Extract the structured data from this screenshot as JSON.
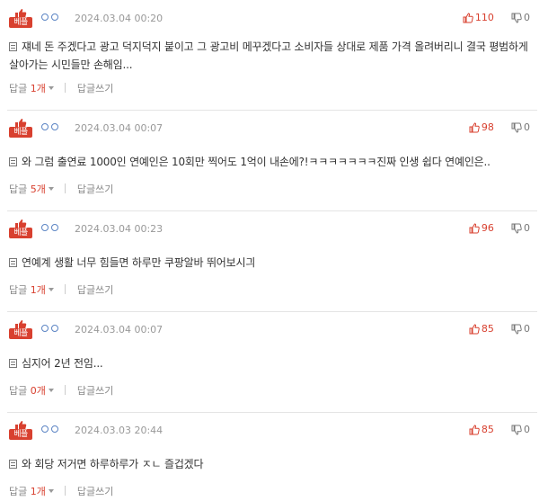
{
  "badge_label": "베플",
  "reply_write_label": "답글쓰기",
  "colors": {
    "accent": "#d8402f",
    "anon_circle": "#5b84c4"
  },
  "comments": [
    {
      "date": "2024.03.04 00:20",
      "up": "110",
      "down": "0",
      "text": "쟤네 돈 주겠다고 광고 덕지덕지 붙이고 그 광고비 메꾸겠다고 소비자들 상대로 제품 가격 올려버리니 결국 평범하게 살아가는 시민들만 손해임...",
      "reply_prefix": "답글",
      "reply_count": "1개"
    },
    {
      "date": "2024.03.04 00:07",
      "up": "98",
      "down": "0",
      "text": "와 그럼 출연료 1000인 연예인은 10회만 찍어도 1억이 내손에?!ㅋㅋㅋㅋㅋㅋㅋ진짜 인생 쉽다 연예인은..",
      "reply_prefix": "답글",
      "reply_count": "5개"
    },
    {
      "date": "2024.03.04 00:23",
      "up": "96",
      "down": "0",
      "text": "연예계 생활 너무 힘들면 하루만 쿠팡알바 뛰어보시긔",
      "reply_prefix": "답글",
      "reply_count": "1개"
    },
    {
      "date": "2024.03.04 00:07",
      "up": "85",
      "down": "0",
      "text": "심지어 2년 전임...",
      "reply_prefix": "답글",
      "reply_count": "0개"
    },
    {
      "date": "2024.03.03 20:44",
      "up": "85",
      "down": "0",
      "text": "와 회당 저거면 하루하루가 ㅈㄴ 즐겁겠다",
      "reply_prefix": "답글",
      "reply_count": "1개"
    }
  ]
}
